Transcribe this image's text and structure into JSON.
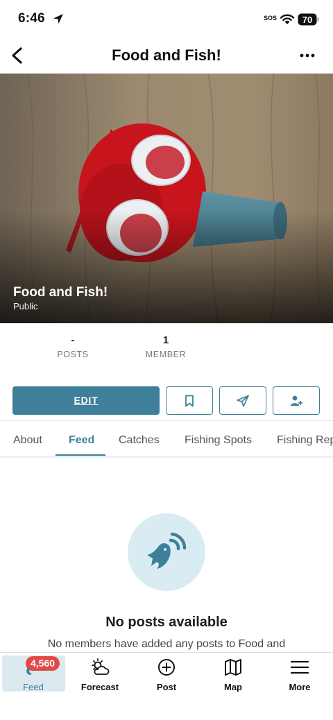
{
  "status_bar": {
    "time": "6:46",
    "sos": "SOS",
    "battery": "70"
  },
  "header": {
    "title": "Food and Fish!",
    "back_icon": "chevron-left-icon",
    "more_icon": "ellipsis-icon"
  },
  "hero": {
    "name": "Food and Fish!",
    "visibility": "Public"
  },
  "stats": [
    {
      "value": "-",
      "label": "POSTS"
    },
    {
      "value": "1",
      "label": "MEMBER"
    }
  ],
  "actions": {
    "edit_label": "EDIT",
    "bookmark_icon": "bookmark-icon",
    "share_icon": "send-icon",
    "invite_icon": "add-user-icon"
  },
  "tabs": [
    {
      "label": "About"
    },
    {
      "label": "Feed",
      "active": true
    },
    {
      "label": "Catches"
    },
    {
      "label": "Fishing Spots"
    },
    {
      "label": "Fishing Rep"
    }
  ],
  "empty_state": {
    "icon": "fish-signal-icon",
    "title": "No posts available",
    "description": "No members have added any posts to Food and"
  },
  "bottom_nav": {
    "items": [
      {
        "label": "Feed",
        "icon": "feed-icon",
        "badge": "4,560",
        "active": true
      },
      {
        "label": "Forecast",
        "icon": "cloud-sun-icon"
      },
      {
        "label": "Post",
        "icon": "plus-circle-icon"
      },
      {
        "label": "Map",
        "icon": "map-icon"
      },
      {
        "label": "More",
        "icon": "menu-icon"
      }
    ]
  },
  "colors": {
    "accent": "#3f7f99",
    "accent_light": "#d9ebf3",
    "badge": "#e0484a"
  }
}
